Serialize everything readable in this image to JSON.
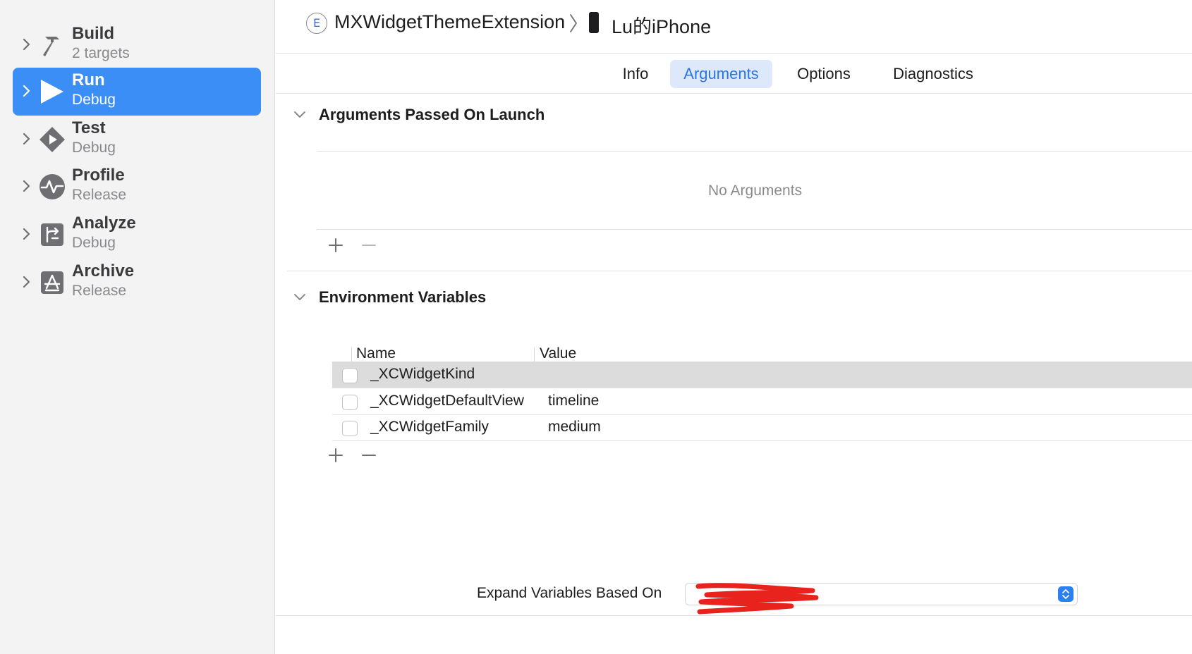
{
  "sidebar": {
    "items": [
      {
        "title": "Build",
        "subtitle": "2 targets",
        "icon": "hammer-icon",
        "selected": false
      },
      {
        "title": "Run",
        "subtitle": "Debug",
        "icon": "play-icon",
        "selected": true
      },
      {
        "title": "Test",
        "subtitle": "Debug",
        "icon": "test-diamond-icon",
        "selected": false
      },
      {
        "title": "Profile",
        "subtitle": "Release",
        "icon": "profile-waveform-icon",
        "selected": false
      },
      {
        "title": "Analyze",
        "subtitle": "Debug",
        "icon": "analyze-branch-icon",
        "selected": false
      },
      {
        "title": "Archive",
        "subtitle": "Release",
        "icon": "archive-appstore-icon",
        "selected": false
      }
    ]
  },
  "header": {
    "scheme_badge": "E",
    "scheme_name": "MXWidgetThemeExtension",
    "device_name": "Lu的iPhone"
  },
  "tabs": [
    {
      "label": "Info",
      "active": false
    },
    {
      "label": "Arguments",
      "active": true
    },
    {
      "label": "Options",
      "active": false
    },
    {
      "label": "Diagnostics",
      "active": false
    }
  ],
  "arguments_section": {
    "title": "Arguments Passed On Launch",
    "empty_message": "No Arguments"
  },
  "env_section": {
    "title": "Environment Variables",
    "columns": [
      "Name",
      "Value"
    ],
    "rows": [
      {
        "name": "_XCWidgetKind",
        "value": "",
        "checked": false
      },
      {
        "name": "_XCWidgetDefaultView",
        "value": "timeline",
        "checked": false
      },
      {
        "name": "_XCWidgetFamily",
        "value": "medium",
        "checked": false
      }
    ]
  },
  "expand": {
    "label": "Expand Variables Based On",
    "selected_value": "",
    "redacted": true
  },
  "colors": {
    "accent": "#3a8ef6",
    "active_tab_text": "#2a75e4",
    "active_tab_bg": "#dde9fb",
    "redaction": "#e8231e"
  }
}
